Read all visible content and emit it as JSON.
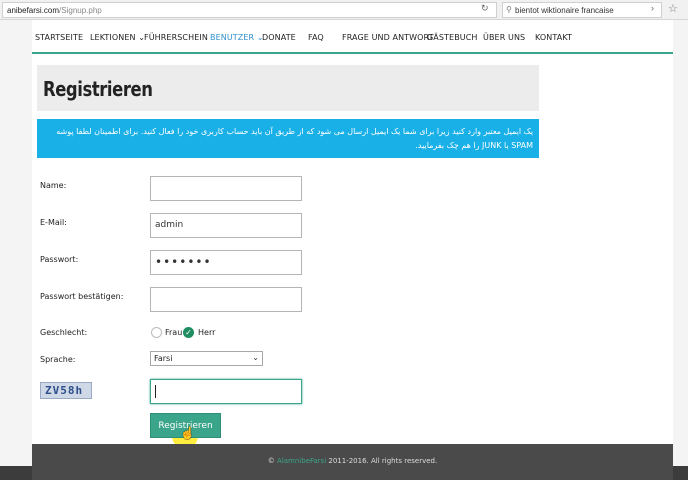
{
  "browser": {
    "url_host": "anibefarsi.com",
    "url_path": "/Signup.php",
    "search_text": "bientot wiktionaire francaise"
  },
  "nav": {
    "items": [
      {
        "label": "STARTSEITE",
        "active": false
      },
      {
        "label": "LEKTIONEN",
        "dropdown": true,
        "active": false
      },
      {
        "label": "FÜHRERSCHEIN",
        "active": false
      },
      {
        "label": "BENUTZER",
        "dropdown": true,
        "active": true
      },
      {
        "label": "DONATE",
        "active": false
      },
      {
        "label": "FAQ",
        "active": false
      },
      {
        "label": "FRAGE UND ANTWORT",
        "active": false
      },
      {
        "label": "GÄSTEBUCH",
        "active": false
      },
      {
        "label": "ÜBER UNS",
        "active": false
      },
      {
        "label": "KONTAKT",
        "active": false
      }
    ]
  },
  "page": {
    "title": "Registrieren",
    "info_text": "یک ایمیل معتبر وارد کنید زیرا برای شما یک ایمیل ارسال می شود که از طریق آن باید حساب کاربری خود را فعال کنید. برای اطمینان لطفا پوشه SPAM یا JUNK را هم چک بفرمایید."
  },
  "form": {
    "name_label": "Name:",
    "name_value": "",
    "email_label": "E-Mail:",
    "email_value": "admin",
    "password_label": "Passwort:",
    "password_value": "•••••••",
    "password_confirm_label": "Passwort bestätigen:",
    "password_confirm_value": "",
    "gender_label": "Geschlecht:",
    "gender_options": [
      "Frau",
      "Herr"
    ],
    "gender_selected": "Herr",
    "language_label": "Sprache:",
    "language_value": "Farsi",
    "captcha_text": "ZV58h",
    "captcha_value": "",
    "submit_label": "Registrieren"
  },
  "footer": {
    "prefix": "©",
    "brand": "AlamnibeFarsi",
    "text": "2011-2016. All rights reserved."
  },
  "colors": {
    "accent": "#3aa58a",
    "info": "#19b0e8",
    "nav_active": "#2f8fce"
  }
}
